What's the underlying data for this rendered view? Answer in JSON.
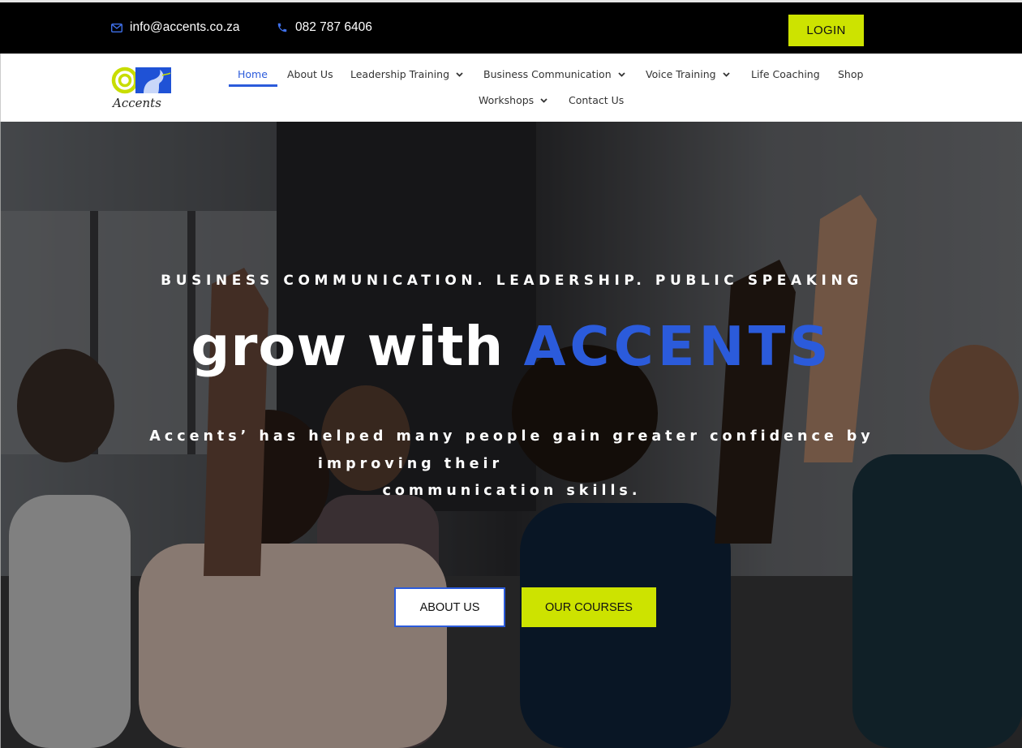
{
  "topbar": {
    "email": "info@accents.co.za",
    "phone": "082 787 6406",
    "login_label": "LOGIN",
    "accent_color": "#cde300"
  },
  "logo": {
    "text": "Accents"
  },
  "nav": {
    "items": [
      {
        "label": "Home",
        "active": true,
        "dropdown": false
      },
      {
        "label": "About Us",
        "dropdown": false
      },
      {
        "label": "Leadership Training",
        "dropdown": true
      },
      {
        "label": "Business Communication",
        "dropdown": true
      },
      {
        "label": "Voice Training",
        "dropdown": true
      },
      {
        "label": "Life Coaching",
        "dropdown": false
      },
      {
        "label": "Shop",
        "dropdown": false
      },
      {
        "label": "Workshops",
        "dropdown": true
      },
      {
        "label": "Contact Us",
        "dropdown": false
      }
    ],
    "active_color": "#2b5bdb"
  },
  "hero": {
    "kicker": "BUSINESS COMMUNICATION. LEADERSHIP. PUBLIC SPEAKING",
    "headline_prefix": "grow with",
    "headline_brand": "ACCENTS",
    "subtitle_line1": "Accents’ has helped many people gain greater confidence by",
    "subtitle_line2": "improving their",
    "subtitle_line3": "communication skills.",
    "about_button": "ABOUT US",
    "courses_button": "OUR COURSES",
    "brand_color": "#2b5bdb"
  }
}
